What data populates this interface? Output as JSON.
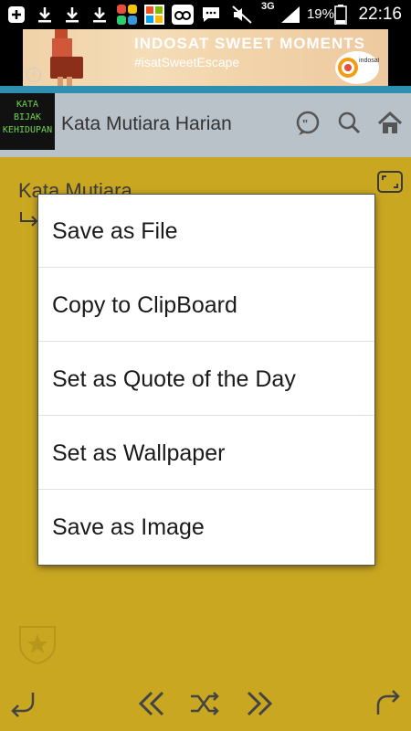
{
  "status_bar": {
    "network": "3G",
    "battery_percent": "19%",
    "time": "22:16",
    "icons": [
      "add-icon",
      "download-icon",
      "download-icon",
      "download-icon",
      "chat-app-icon",
      "office-app-icon",
      "tripadvisor-icon",
      "message-icon",
      "mute-icon",
      "signal-icon",
      "battery-icon"
    ]
  },
  "ad": {
    "title": "INDOSAT SWEET MOMENTS",
    "tagline": "#isatSweetEscape",
    "brand": "indosat",
    "info_label": "i"
  },
  "app_bar": {
    "logo_lines": [
      "KATA",
      "BIJAK",
      "KEHIDUPAN"
    ],
    "title": "Kata Mutiara Harian",
    "accent_color": "#2e8fb0"
  },
  "content": {
    "heading": "Kata Mutiara",
    "background_color": "#c9a721"
  },
  "menu": {
    "items": [
      {
        "label": "Save as File"
      },
      {
        "label": "Copy to ClipBoard"
      },
      {
        "label": "Set as Quote of the Day"
      },
      {
        "label": "Set as Wallpaper"
      },
      {
        "label": "Save as Image"
      }
    ]
  },
  "bottom_bar": {
    "icons": [
      "reply-icon",
      "previous-icon",
      "shuffle-icon",
      "next-icon",
      "forward-icon"
    ]
  }
}
